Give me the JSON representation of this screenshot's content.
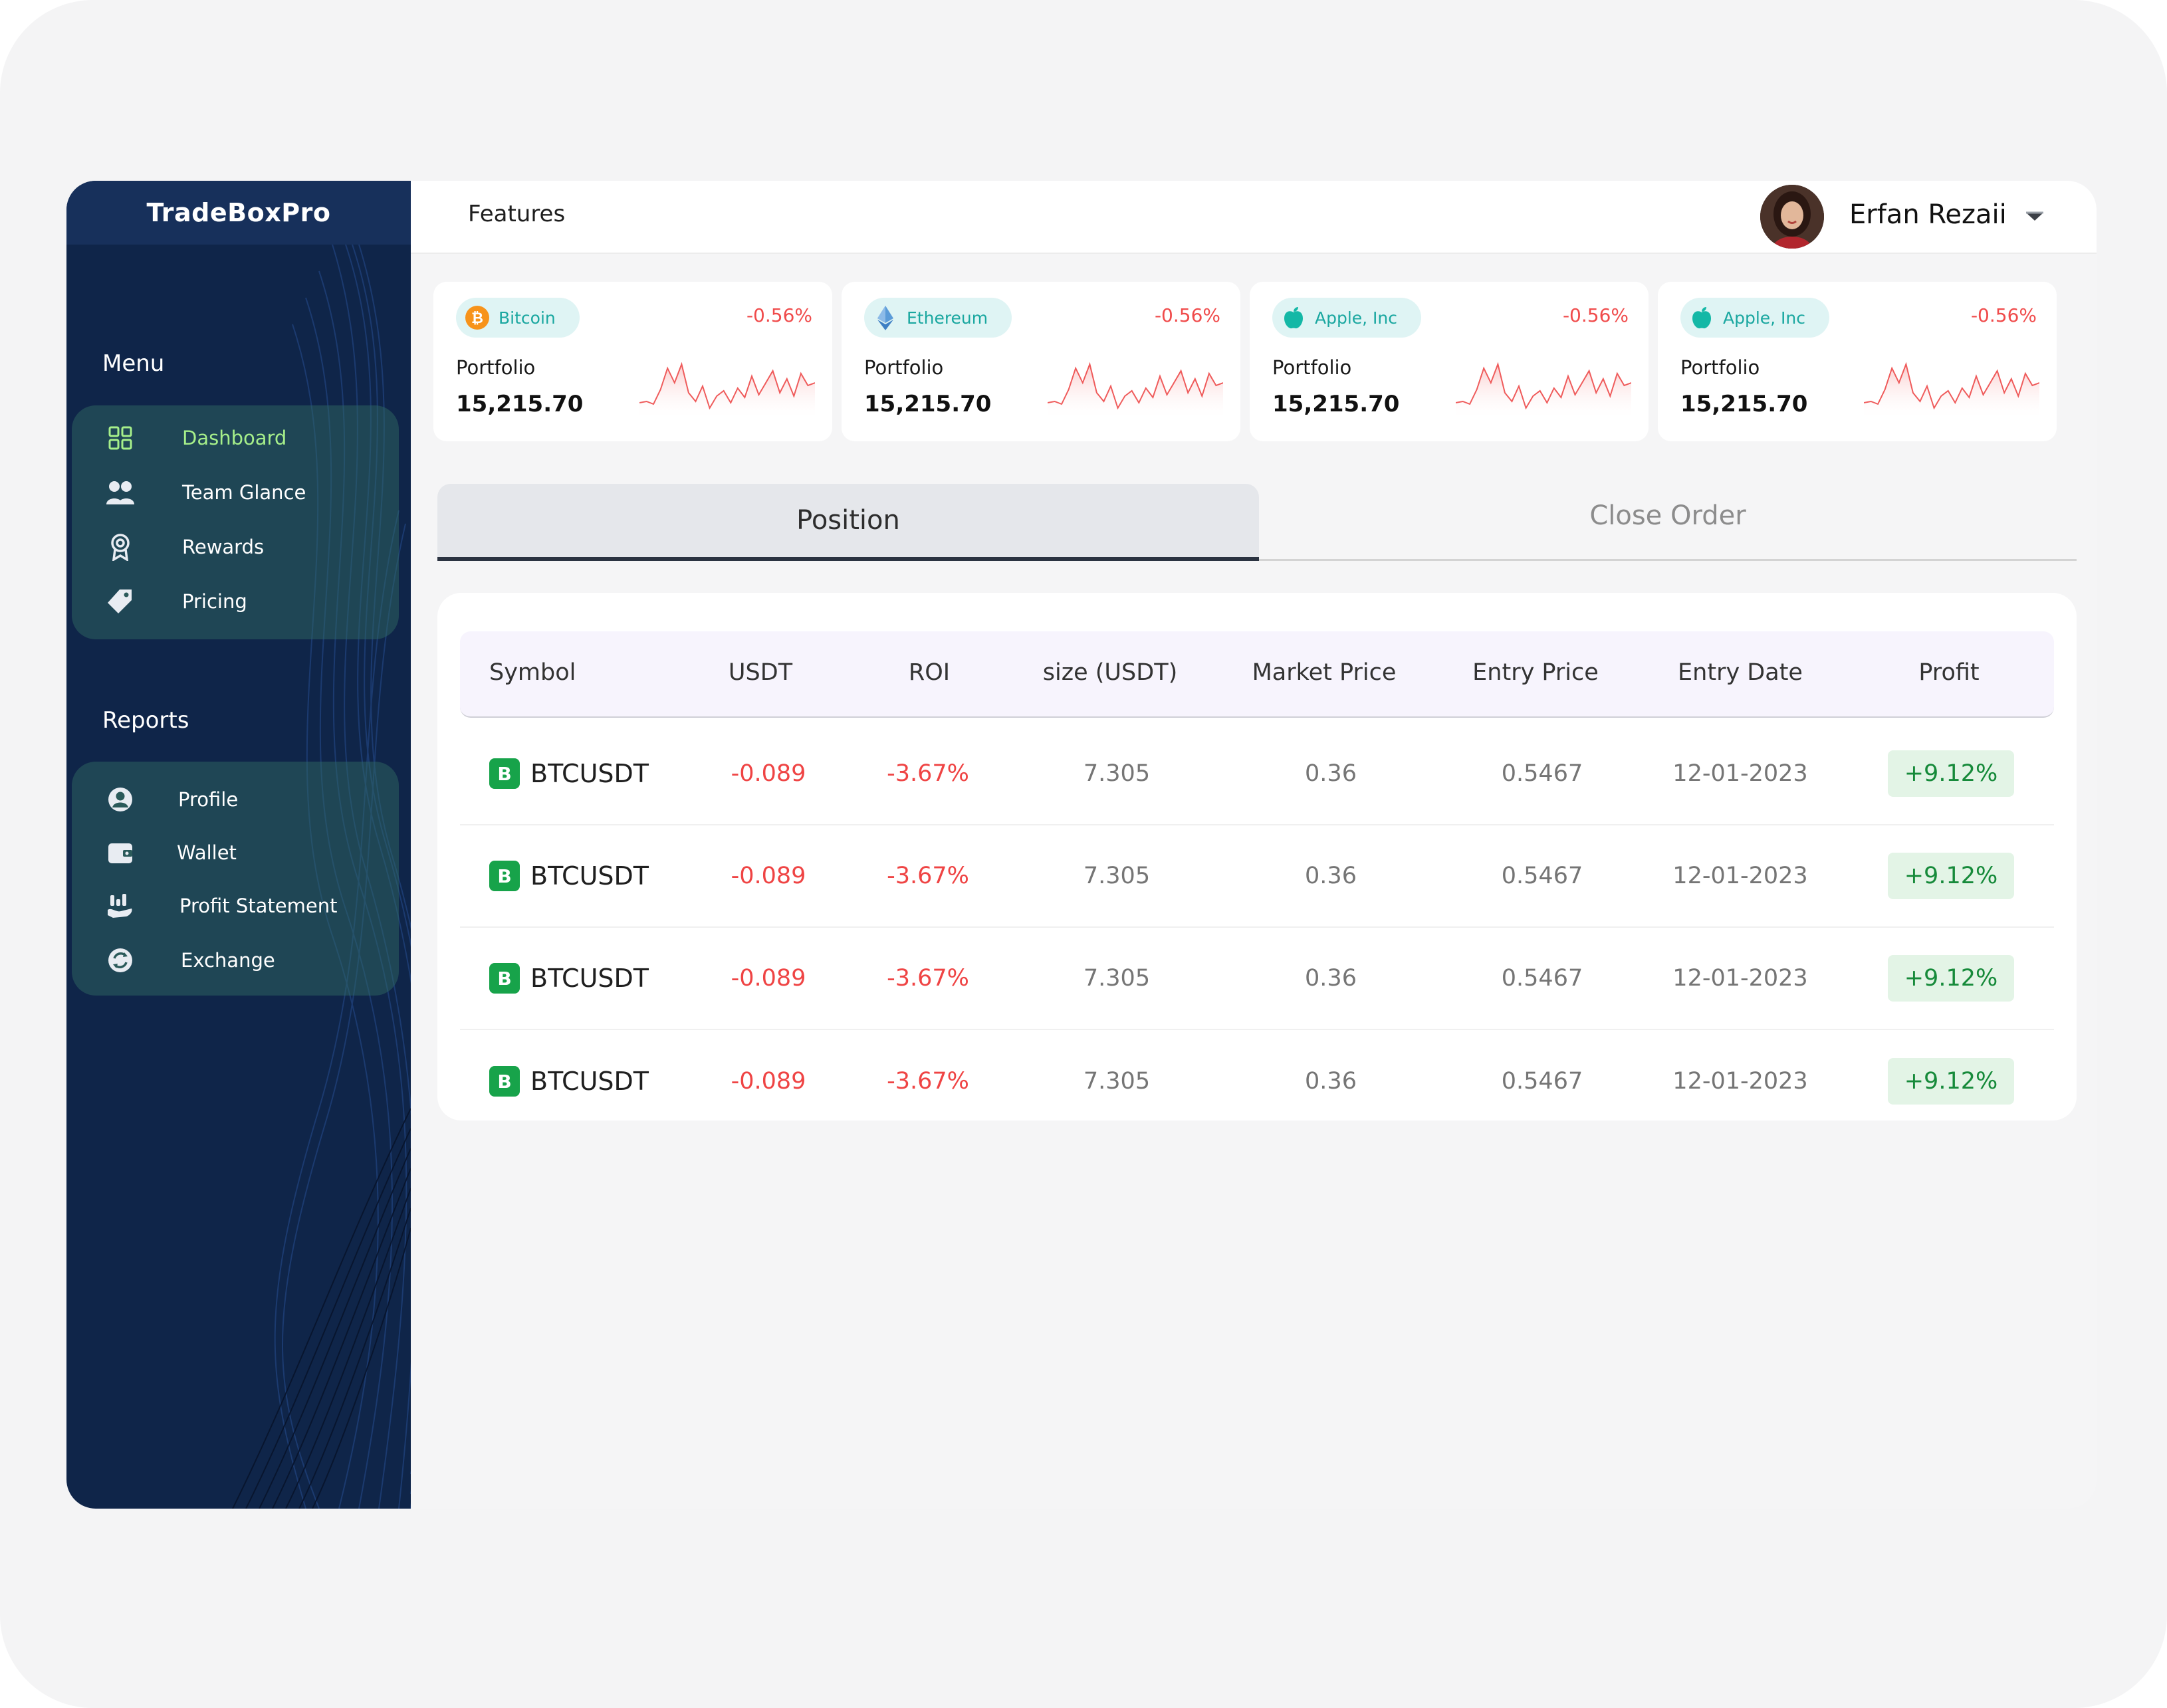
{
  "app": {
    "brand": "TradeBoxPro",
    "header_title": "Features",
    "user_name": "Erfan Rezaii"
  },
  "sidebar": {
    "menu_title": "Menu",
    "menu_items": [
      {
        "label": "Dashboard",
        "icon": "dashboard-icon",
        "active": true
      },
      {
        "label": "Team Glance",
        "icon": "team-icon"
      },
      {
        "label": "Rewards",
        "icon": "rewards-icon"
      },
      {
        "label": "Pricing",
        "icon": "tag-icon"
      }
    ],
    "reports_title": "Reports",
    "report_items": [
      {
        "label": "Profile",
        "icon": "profile-icon"
      },
      {
        "label": "Wallet",
        "icon": "wallet-icon"
      },
      {
        "label": "Profit Statement",
        "icon": "profit-statement-icon"
      },
      {
        "label": "Exchange",
        "icon": "exchange-icon"
      }
    ]
  },
  "cards": [
    {
      "asset": "Bitcoin",
      "icon": "bitcoin-icon",
      "change": "-0.56%",
      "label": "Portfolio",
      "value": "15,215.70"
    },
    {
      "asset": "Ethereum",
      "icon": "ethereum-icon",
      "change": "-0.56%",
      "label": "Portfolio",
      "value": "15,215.70"
    },
    {
      "asset": "Apple, Inc",
      "icon": "apple-icon",
      "change": "-0.56%",
      "label": "Portfolio",
      "value": "15,215.70"
    },
    {
      "asset": "Apple, Inc",
      "icon": "apple-icon",
      "change": "-0.56%",
      "label": "Portfolio",
      "value": "15,215.70"
    }
  ],
  "tabs": {
    "position": "Position",
    "close_order": "Close Order"
  },
  "table": {
    "headers": [
      "Symbol",
      "USDT",
      "ROI",
      "size (USDT)",
      "Market Price",
      "Entry Price",
      "Entry Date",
      "Profit"
    ],
    "rows": [
      {
        "badge": "B",
        "symbol": "BTCUSDT",
        "usdt": "-0.089",
        "roi": "-3.67%",
        "size": "7.305",
        "market": "0.36",
        "entry": "0.5467",
        "date": "12-01-2023",
        "profit": "+9.12%"
      },
      {
        "badge": "B",
        "symbol": "BTCUSDT",
        "usdt": "-0.089",
        "roi": "-3.67%",
        "size": "7.305",
        "market": "0.36",
        "entry": "0.5467",
        "date": "12-01-2023",
        "profit": "+9.12%"
      },
      {
        "badge": "B",
        "symbol": "BTCUSDT",
        "usdt": "-0.089",
        "roi": "-3.67%",
        "size": "7.305",
        "market": "0.36",
        "entry": "0.5467",
        "date": "12-01-2023",
        "profit": "+9.12%"
      },
      {
        "badge": "B",
        "symbol": "BTCUSDT",
        "usdt": "-0.089",
        "roi": "-3.67%",
        "size": "7.305",
        "market": "0.36",
        "entry": "0.5467",
        "date": "12-01-2023",
        "profit": "+9.12%"
      }
    ]
  },
  "colors": {
    "sidebar_bg": "#0f2549",
    "active_nav": "#a6ef8a",
    "negative": "#ef4444",
    "positive": "#168a3a",
    "pill_text": "#1aa7a0"
  }
}
